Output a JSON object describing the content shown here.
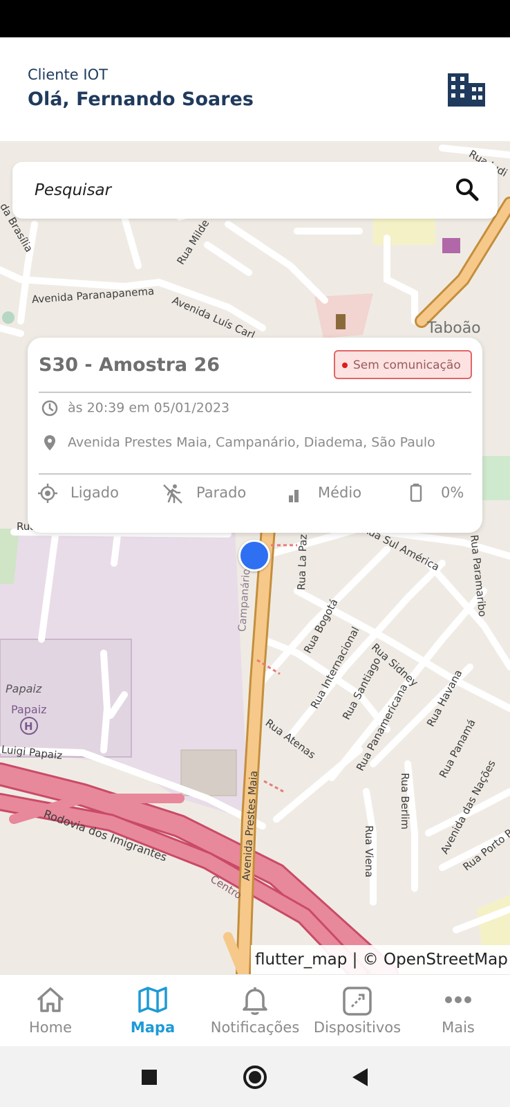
{
  "header": {
    "subtitle": "Cliente IOT",
    "greeting": "Olá, Fernando Soares",
    "icon": "building-icon"
  },
  "search": {
    "placeholder": "Pesquisar",
    "icon": "search-icon"
  },
  "map": {
    "labels": {
      "av_paranapanema": "Avenida Paranapanema",
      "av_luis_carlos": "Avenida Luís Carl",
      "rua_mildes": "Rua Milde",
      "av_brasilia": "da Brasília",
      "rua_iudi": "Rua Iudi",
      "taboao": "Taboão",
      "rua_luiz_merenda": "Rua Luiz Merenda",
      "rua_la_paz": "Rua La Paz",
      "rua_sul_america": "Rua Sul América",
      "rua_paramaribo": "Rua Paramaribo",
      "rua_bogota": "Rua Bogotá",
      "rua_internacional": "Rua Internacional",
      "rua_sidney": "Rua Sidney",
      "rua_santiago": "Rua Santiago",
      "rua_panamericana": "Rua Panamericana",
      "rua_havana": "Rua Havana",
      "rua_atenas": "Rua Atenas",
      "rua_viena": "Rua Viena",
      "rua_berlim": "Rua Berlim",
      "rua_panama": "Rua Panamá",
      "av_das_nacoes": "Avenida das Nações",
      "rua_porto_r": "Rua Porto R",
      "campanario": "Campanário",
      "papaiz_area": "Papaiz",
      "papaiz_poi": "Papaiz",
      "luigi_papaiz": "Luigi Papaiz",
      "av_prestes_maia": "Avenida Prestes Maia",
      "rodovia": "Rodovia dos Imigrantes",
      "centro": "Centro"
    },
    "attribution": "flutter_map | © OpenStreetMap"
  },
  "device_card": {
    "name": "S30 - Amostra 26",
    "status_badge": "Sem comunicação",
    "status_color": "#e01b1b",
    "timestamp": "às 20:39 em 05/01/2023",
    "address": "Avenida Prestes Maia, Campanário, Diadema, São Paulo",
    "stats": [
      {
        "icon": "gps-fixed-icon",
        "label": "Ligado"
      },
      {
        "icon": "not-moving-icon",
        "label": "Parado"
      },
      {
        "icon": "signal-bars-icon",
        "label": "Médio"
      },
      {
        "icon": "battery-icon",
        "label": "0%"
      }
    ]
  },
  "bottom_nav": {
    "active_color": "#1d9ad6",
    "items": [
      {
        "label": "Home",
        "icon": "home-icon"
      },
      {
        "label": "Mapa",
        "icon": "map-icon"
      },
      {
        "label": "Notificações",
        "icon": "bell-icon"
      },
      {
        "label": "Dispositivos",
        "icon": "devices-icon"
      },
      {
        "label": "Mais",
        "icon": "more-icon"
      }
    ]
  }
}
